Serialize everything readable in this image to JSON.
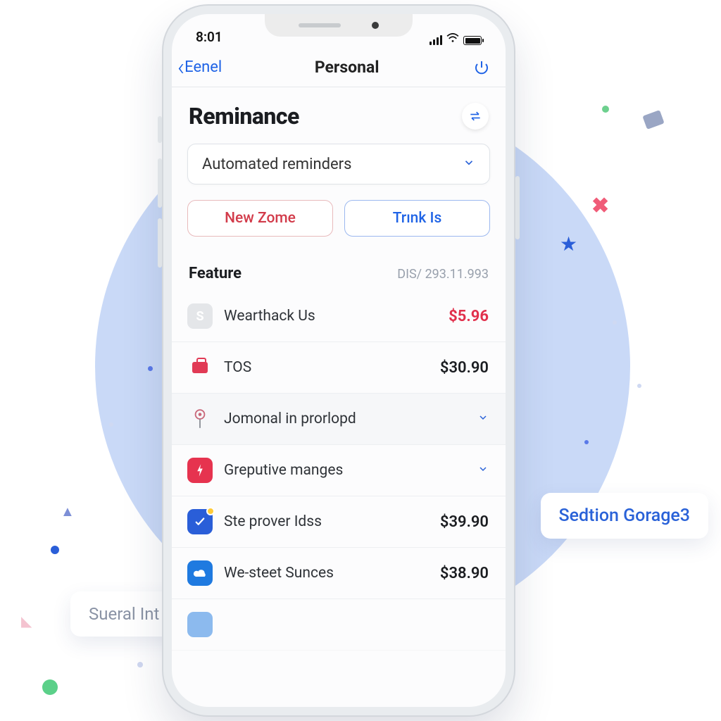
{
  "statusbar": {
    "time": "8:01"
  },
  "nav": {
    "back": "Eenel",
    "title": "Personal"
  },
  "page": {
    "heading": "Reminance"
  },
  "dropdown": {
    "selected": "Automated reminders"
  },
  "buttons": {
    "danger": "New Zome",
    "primary": "Trınk Is"
  },
  "feature": {
    "label": "Feature",
    "meta": "DIS/ 293.11.993"
  },
  "rows": [
    {
      "icon_name": "dollar-icon",
      "label": "Wearthack Us",
      "amount": "$5.96",
      "amount_red": true,
      "expandable": false
    },
    {
      "icon_name": "briefcase-icon",
      "label": "TOS",
      "amount": "$30.90",
      "amount_red": false,
      "expandable": false
    },
    {
      "icon_name": "pin-icon",
      "label": "Jomonal in prorlopd",
      "amount": "",
      "amount_red": false,
      "expandable": true
    },
    {
      "icon_name": "bolt-icon",
      "label": "Greputive manges",
      "amount": "",
      "amount_red": false,
      "expandable": true
    },
    {
      "icon_name": "check-icon",
      "label": "Ste prover Idss",
      "amount": "$39.90",
      "amount_red": false,
      "expandable": false
    },
    {
      "icon_name": "cloud-icon",
      "label": "We-steet Sunces",
      "amount": "$38.90",
      "amount_red": false,
      "expandable": false
    }
  ],
  "float": {
    "right": "Sedtion Gorage3",
    "left": "Sueral Int"
  }
}
